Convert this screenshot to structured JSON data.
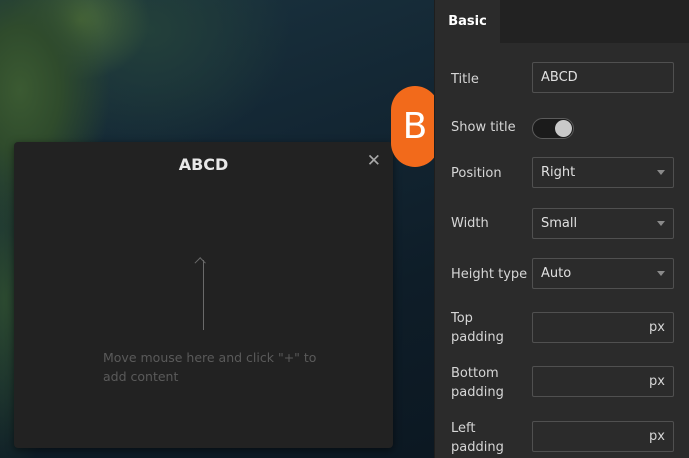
{
  "popup": {
    "title": "ABCD",
    "close_glyph": "✕",
    "hint": "Move mouse here and click \"+\" to add content"
  },
  "badge": {
    "letter": "B",
    "color": "#f26a1b"
  },
  "panel": {
    "tab": "Basic",
    "title_label": "Title",
    "title_value": "ABCD",
    "show_title_label": "Show title",
    "show_title_on": true,
    "position_label": "Position",
    "position_value": "Right",
    "width_label": "Width",
    "width_value": "Small",
    "height_type_label": "Height type",
    "height_type_value": "Auto",
    "top_padding_label": "Top padding",
    "top_padding_unit": "px",
    "bottom_padding_label": "Bottom padding",
    "bottom_padding_unit": "px",
    "left_padding_label": "Left padding",
    "left_padding_unit": "px"
  }
}
